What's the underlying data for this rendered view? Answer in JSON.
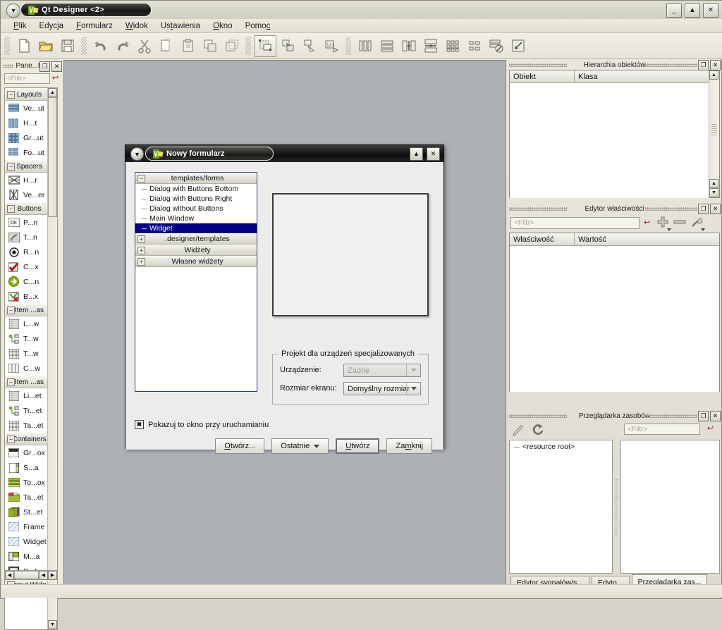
{
  "window": {
    "title": "Qt Designer <2>",
    "logo_icon": "qt-logo-icon",
    "left_menu_icon": "window-menu-icon",
    "buttons": [
      {
        "name": "minimize-button",
        "glyph": "_"
      },
      {
        "name": "maximize-button",
        "glyph": "▲"
      },
      {
        "name": "close-button",
        "glyph": "✕"
      }
    ]
  },
  "menubar": {
    "items": [
      {
        "label": "Plik",
        "accel": "P"
      },
      {
        "label": "Edycja",
        "accel": "E"
      },
      {
        "label": "Formularz",
        "accel": "F"
      },
      {
        "label": "Widok",
        "accel": "W"
      },
      {
        "label": "Ustawienia",
        "accel": "t"
      },
      {
        "label": "Okno",
        "accel": "O"
      },
      {
        "label": "Pomoc",
        "accel": "c"
      }
    ]
  },
  "toolbar": {
    "groups": [
      [
        "new-file-icon",
        "open-folder-icon",
        "save-icon"
      ],
      [
        "undo-icon",
        "redo-icon",
        "cut-icon",
        "copy-icon",
        "paste-icon",
        "duplicate-icon",
        "delete-icon"
      ],
      [
        "edit-widgets-icon",
        "edit-signals-icon",
        "edit-buddies-icon",
        "edit-tab-order-icon"
      ],
      [
        "layout-horizontal-icon",
        "layout-vertical-icon",
        "layout-splitter-h-icon",
        "layout-splitter-v-icon",
        "layout-grid-icon",
        "layout-form-icon",
        "break-layout-icon",
        "adjust-size-icon"
      ]
    ],
    "selected": "edit-widgets-icon"
  },
  "widgetbox": {
    "title": "Pane...tów",
    "filter_placeholder": "<Filtr>",
    "undo_icon": "clear-filter-icon",
    "dock_buttons": [
      {
        "name": "float-button",
        "glyph": "❐"
      },
      {
        "name": "close-button",
        "glyph": "✕"
      }
    ],
    "categories": [
      {
        "label": "Layouts",
        "expanded": true,
        "items": [
          {
            "label": "Ve...ut",
            "icon": "vertical-layout-icon"
          },
          {
            "label": "H...t",
            "icon": "horizontal-layout-icon"
          },
          {
            "label": "Gr...ut",
            "icon": "grid-layout-icon"
          },
          {
            "label": "Fo...ut",
            "icon": "form-layout-icon"
          }
        ]
      },
      {
        "label": "Spacers",
        "expanded": true,
        "items": [
          {
            "label": "H...r",
            "icon": "horizontal-spacer-icon"
          },
          {
            "label": "Ve...er",
            "icon": "vertical-spacer-icon"
          }
        ]
      },
      {
        "label": "Buttons",
        "expanded": true,
        "items": [
          {
            "label": "P...n",
            "icon": "push-button-icon"
          },
          {
            "label": "T...n",
            "icon": "tool-button-icon"
          },
          {
            "label": "R...n",
            "icon": "radio-button-icon"
          },
          {
            "label": "C...x",
            "icon": "check-box-icon"
          },
          {
            "label": "C...n",
            "icon": "command-link-button-icon"
          },
          {
            "label": "B...x",
            "icon": "dialog-button-box-icon"
          }
        ]
      },
      {
        "label": "Item ...as",
        "expanded": true,
        "items": [
          {
            "label": "L...w",
            "icon": "list-view-icon"
          },
          {
            "label": "T...w",
            "icon": "tree-view-icon"
          },
          {
            "label": "T...w",
            "icon": "table-view-icon"
          },
          {
            "label": "C...w",
            "icon": "column-view-icon"
          }
        ]
      },
      {
        "label": "Item ...as",
        "expanded": true,
        "items": [
          {
            "label": "Li...et",
            "icon": "list-widget-icon"
          },
          {
            "label": "Tr...et",
            "icon": "tree-widget-icon"
          },
          {
            "label": "Ta...et",
            "icon": "table-widget-icon"
          }
        ]
      },
      {
        "label": "Containers",
        "expanded": true,
        "items": [
          {
            "label": "Gr...ox",
            "icon": "group-box-icon"
          },
          {
            "label": "S...a",
            "icon": "scroll-area-icon"
          },
          {
            "label": "To...ox",
            "icon": "tool-box-icon"
          },
          {
            "label": "Ta...et",
            "icon": "tab-widget-icon"
          },
          {
            "label": "St...et",
            "icon": "stacked-widget-icon"
          },
          {
            "label": "Frame",
            "icon": "frame-icon"
          },
          {
            "label": "Widget",
            "icon": "widget-icon"
          },
          {
            "label": "M...a",
            "icon": "mdi-area-icon"
          },
          {
            "label": "D...t",
            "icon": "dock-widget-icon"
          }
        ]
      },
      {
        "label": "Input Widg",
        "expanded": false,
        "items": []
      }
    ]
  },
  "dialog": {
    "title": "Nowy formularz",
    "logo_icon": "qt-logo-icon",
    "menu_icon": "window-menu-icon",
    "buttons": [
      {
        "name": "shade-button",
        "glyph": "▲"
      },
      {
        "name": "close-button",
        "glyph": "✕"
      }
    ],
    "tree": [
      {
        "type": "group",
        "label": "templates/forms",
        "expanded": true
      },
      {
        "type": "leaf",
        "label": "Dialog with Buttons Bottom",
        "selected": false
      },
      {
        "type": "leaf",
        "label": "Dialog with Buttons Right",
        "selected": false
      },
      {
        "type": "leaf",
        "label": "Dialog without Buttons",
        "selected": false
      },
      {
        "type": "leaf",
        "label": "Main Window",
        "selected": false
      },
      {
        "type": "leaf",
        "label": "Widget",
        "selected": true
      },
      {
        "type": "group",
        "label": ".designer/templates",
        "expanded": false
      },
      {
        "type": "group",
        "label": "Widżety",
        "expanded": false
      },
      {
        "type": "group",
        "label": "Własne widżety",
        "expanded": false
      }
    ],
    "preview_name": "template-preview",
    "embedded_group": {
      "legend": "Projekt dla urządzeń specjalizowanych",
      "device_label": "Urządzenie:",
      "device_value": "Żadne",
      "device_disabled": true,
      "screen_label": "Rozmiar ekranu:",
      "screen_value": "Domyślny rozmiar"
    },
    "checkbox": {
      "label": "Pokazuj to okno przy uruchamianiu",
      "checked": true,
      "glyph": "✖"
    },
    "buttons_row": [
      {
        "name": "open-button",
        "label": "Otwórz...",
        "accel": "O",
        "default": false,
        "dropdown": false
      },
      {
        "name": "recent-button",
        "label": "Ostatnie",
        "accel": "",
        "default": false,
        "dropdown": true
      },
      {
        "name": "create-button",
        "label": "Utwórz",
        "accel": "U",
        "default": true,
        "dropdown": false
      },
      {
        "name": "close-button",
        "label": "Zamknij",
        "accel": "m",
        "default": false,
        "dropdown": false
      }
    ]
  },
  "object_inspector": {
    "title": "Hierarchia obiektów",
    "dock_buttons": [
      {
        "name": "float-button",
        "glyph": "❐"
      },
      {
        "name": "close-button",
        "glyph": "✕"
      }
    ],
    "columns": [
      "Obiekt",
      "Klasa"
    ],
    "rows": []
  },
  "property_editor": {
    "title": "Edytor właściwości",
    "dock_buttons": [
      {
        "name": "float-button",
        "glyph": "❐"
      },
      {
        "name": "close-button",
        "glyph": "✕"
      }
    ],
    "filter_placeholder": "<Filtr>",
    "tool_icons": [
      "clear-filter-icon",
      "add-property-icon",
      "remove-property-icon",
      "configure-icon"
    ],
    "columns": [
      "Właściwość",
      "Wartość"
    ],
    "rows": []
  },
  "resource_browser": {
    "title": "Przeglądarka zasobów",
    "dock_buttons": [
      {
        "name": "float-button",
        "glyph": "❐"
      },
      {
        "name": "close-button",
        "glyph": "✕"
      }
    ],
    "tool_icons": [
      "edit-resources-icon",
      "reload-icon"
    ],
    "filter_placeholder": "<Filtr>",
    "clear_icon": "clear-filter-icon",
    "tree_root": "<resource root>",
    "tabs": [
      {
        "label": "Edytor sygnałów/s...",
        "active": false,
        "name": "tab-signal-slot-editor"
      },
      {
        "label": "Edyto...",
        "active": false,
        "name": "tab-action-editor"
      },
      {
        "label": "Przeglądarka zas...",
        "active": true,
        "name": "tab-resource-browser"
      }
    ]
  },
  "colors": {
    "workspace_bg": "#adb0b5",
    "selection": "#000080",
    "window_bg": "#ece9df",
    "dialog_bg": "#ececec"
  }
}
